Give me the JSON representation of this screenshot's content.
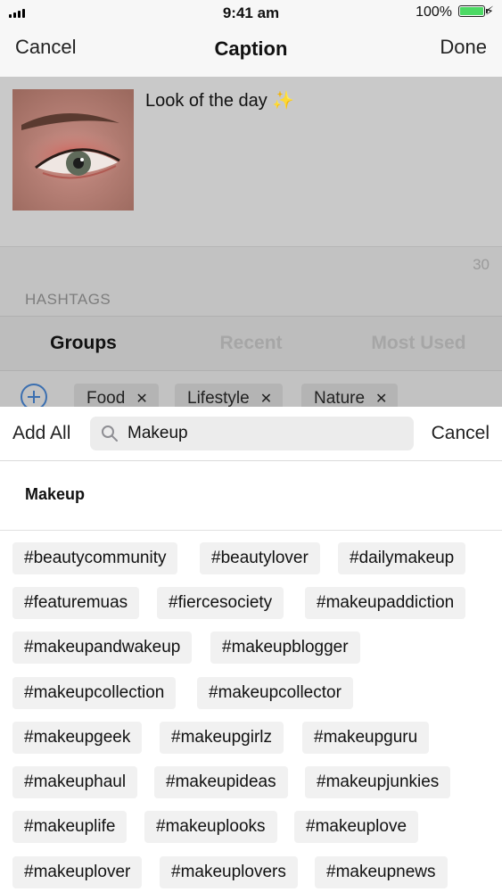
{
  "status_bar": {
    "time": "9:41 am",
    "battery": "100%",
    "bolt": "⚡"
  },
  "nav": {
    "left": "Cancel",
    "title": "Caption",
    "right": "Done"
  },
  "post": {
    "caption": "Look of the day ✨",
    "char_count": "30"
  },
  "hashtags": {
    "header": "HASHTAGS",
    "tabs": [
      "Groups",
      "Recent",
      "Most Used"
    ],
    "groups": [
      "Food",
      "Lifestyle",
      "Nature"
    ],
    "remove_glyph": "✕"
  },
  "search": {
    "add_all": "Add All",
    "value": "Makeup",
    "cancel": "Cancel"
  },
  "result": {
    "group_title": "Makeup",
    "tags": [
      [
        "#beautycommunity",
        "#beautylover",
        "#dailymakeup"
      ],
      [
        "#featuremuas",
        "#fiercesociety",
        "#makeupaddiction"
      ],
      [
        "#makeupandwakeup",
        "#makeupblogger"
      ],
      [
        "#makeupcollection",
        "#makeupcollector"
      ],
      [
        "#makeupgeek",
        "#makeupgirlz",
        "#makeupguru"
      ],
      [
        "#makeuphaul",
        "#makeupideas",
        "#makeupjunkies"
      ],
      [
        "#makeuplife",
        "#makeuplooks",
        "#makeuplove"
      ],
      [
        "#makeuplover",
        "#makeuplovers",
        "#makeupnews"
      ]
    ]
  },
  "colors": {
    "accent": "#3b6fb0",
    "battery": "#4cd964"
  }
}
